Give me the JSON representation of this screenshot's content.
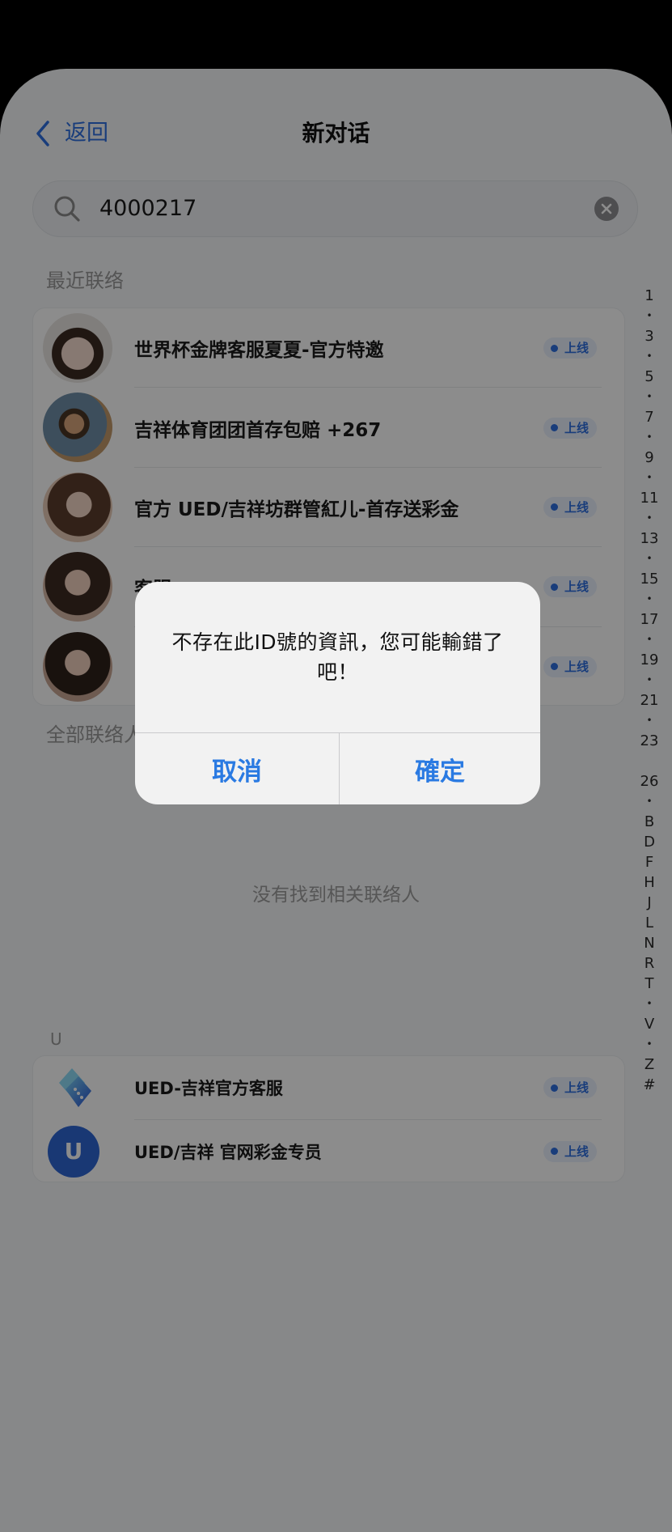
{
  "header": {
    "back_label": "返回",
    "title": "新对话"
  },
  "search": {
    "value": "4000217"
  },
  "recent": {
    "heading": "最近联络",
    "contacts": [
      {
        "name": "世界杯金牌客服夏夏-官方特邀",
        "status": "上线"
      },
      {
        "name": "吉祥体育团团首存包赔 +267",
        "status": "上线"
      },
      {
        "name": "官方 UED/吉祥坊群管紅儿-首存送彩金",
        "status": "上线"
      },
      {
        "name": "客服",
        "status": "上线"
      },
      {
        "status": "上线"
      }
    ]
  },
  "all_contacts": {
    "heading": "全部联络人",
    "empty_text": "没有找到相关联络人"
  },
  "section_u": {
    "letter": "U",
    "contacts": [
      {
        "name": "UED-吉祥官方客服",
        "status": "上线",
        "avatar": "ued-logo-icon"
      },
      {
        "name": "UED/吉祥 官网彩金专员",
        "status": "上线",
        "avatar_letter": "U"
      }
    ]
  },
  "index": [
    "1",
    "•",
    "3",
    "•",
    "5",
    "•",
    "7",
    "•",
    "9",
    "•",
    "11",
    "•",
    "13",
    "•",
    "15",
    "•",
    "17",
    "•",
    "19",
    "•",
    "21",
    "•",
    "23",
    "26",
    "•",
    "B",
    "D",
    "F",
    "H",
    "J",
    "L",
    "N",
    "R",
    "T",
    "•",
    "V",
    "•",
    "Z",
    "#"
  ],
  "dialog": {
    "message": "不存在此ID號的資訊，您可能輸錯了吧！",
    "cancel_label": "取消",
    "confirm_label": "確定"
  },
  "colors": {
    "accent": "#2f6fe0",
    "dialog_button": "#2a7ae2",
    "avatar_u": "#2f66d4",
    "overlay": "rgba(0,0,0,0.45)"
  }
}
